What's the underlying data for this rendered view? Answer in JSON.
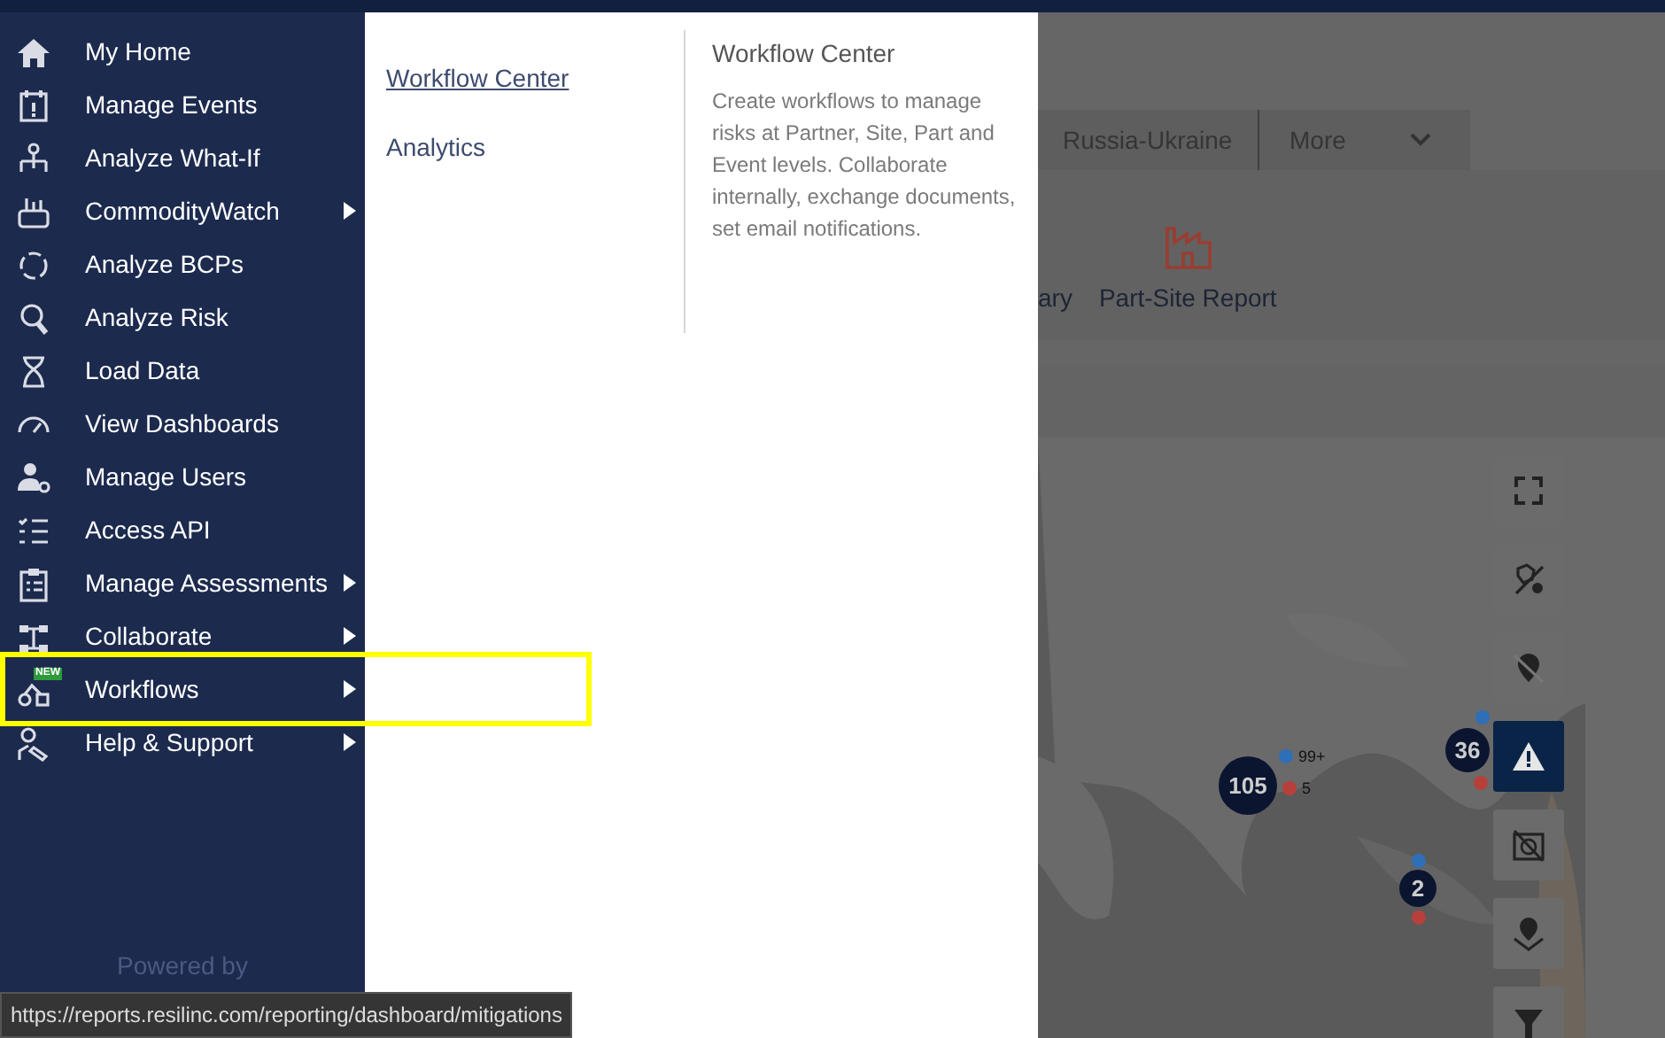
{
  "sidebar": {
    "items": [
      {
        "label": "My Home",
        "submenu": false,
        "highlighted": false
      },
      {
        "label": "Manage Events",
        "submenu": false,
        "highlighted": false
      },
      {
        "label": "Analyze What-If",
        "submenu": false,
        "highlighted": false
      },
      {
        "label": "CommodityWatch",
        "submenu": true,
        "highlighted": false
      },
      {
        "label": "Analyze BCPs",
        "submenu": false,
        "highlighted": false
      },
      {
        "label": "Analyze Risk",
        "submenu": false,
        "highlighted": false
      },
      {
        "label": "Load Data",
        "submenu": false,
        "highlighted": false
      },
      {
        "label": "View Dashboards",
        "submenu": false,
        "highlighted": false
      },
      {
        "label": "Manage Users",
        "submenu": false,
        "highlighted": false
      },
      {
        "label": "Access API",
        "submenu": false,
        "highlighted": false
      },
      {
        "label": "Manage Assessments",
        "submenu": true,
        "highlighted": false
      },
      {
        "label": "Collaborate",
        "submenu": true,
        "highlighted": false
      },
      {
        "label": "Workflows",
        "submenu": true,
        "highlighted": true,
        "badge": "NEW"
      },
      {
        "label": "Help & Support",
        "submenu": true,
        "highlighted": false
      }
    ],
    "footer": "Powered by"
  },
  "flyout": {
    "links": [
      {
        "label": "Workflow Center",
        "selected": true
      },
      {
        "label": "Analytics",
        "selected": false
      }
    ],
    "description": {
      "title": "Workflow Center",
      "text": "Create workflows to manage risks at Partner, Site, Part and Event levels. Collaborate internally, exchange documents, set email notifications."
    }
  },
  "background": {
    "tabs": [
      {
        "label": "Russia-Ukraine",
        "kind": "tab"
      },
      {
        "label": "More",
        "kind": "dropdown"
      }
    ],
    "reports": [
      {
        "label": "ary",
        "kind": "text"
      },
      {
        "label": "Part-Site Report",
        "kind": "factory"
      }
    ],
    "map": {
      "markers": [
        {
          "kind": "cluster",
          "label": "105"
        },
        {
          "kind": "pin",
          "color": "#2f6fb8",
          "label": "99+"
        },
        {
          "kind": "pin",
          "color": "#b8403a",
          "label": "5"
        },
        {
          "kind": "cluster",
          "label": "36"
        },
        {
          "kind": "pin",
          "color": "#2f6fb8"
        },
        {
          "kind": "pin",
          "color": "#b8403a"
        },
        {
          "kind": "cluster",
          "label": "2"
        },
        {
          "kind": "pin",
          "color": "#2f6fb8"
        },
        {
          "kind": "pin",
          "color": "#b8403a"
        }
      ],
      "controls": [
        {
          "selected": false
        },
        {
          "selected": false
        },
        {
          "selected": false
        },
        {
          "selected": true
        },
        {
          "selected": false
        },
        {
          "selected": false
        },
        {
          "selected": false
        }
      ]
    }
  },
  "url_tooltip": "https://reports.resilinc.com/reporting/dashboard/mitigations"
}
